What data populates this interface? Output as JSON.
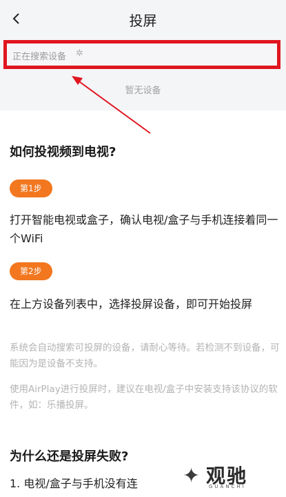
{
  "header": {
    "title": "投屏",
    "back_icon": "chevron-left-icon"
  },
  "search": {
    "status_text": "正在搜索设备",
    "spinner_glyph": "✲",
    "empty_text": "暂无设备"
  },
  "annotation": {
    "box_color": "#e0151f",
    "arrow_color": "#e0151f"
  },
  "guide": {
    "title": "如何投视频到电视?",
    "steps": [
      {
        "badge": "第1步",
        "text": "打开智能电视或盒子，确认电视/盒子与手机连接着同一个WiFi"
      },
      {
        "badge": "第2步",
        "text": "在上方设备列表中，选择投屏设备，即可开始投屏"
      }
    ],
    "notes": [
      "系统会自动搜索可投屏的设备，请耐心等待。若检测不到设备，可能因为是设备不支持。",
      "使用AirPlay进行投屏时，建议在电视/盒子中安装支持该协议的软件，如：乐播投屏。"
    ]
  },
  "failure": {
    "title": "为什么还是投屏失败?",
    "item_1": "1. 电视/盒子与手机没有连"
  },
  "watermark": {
    "text": "观驰",
    "sub": "GUANCHI"
  },
  "colors": {
    "accent": "#f2771f",
    "header_bg": "#f4f5f7"
  }
}
